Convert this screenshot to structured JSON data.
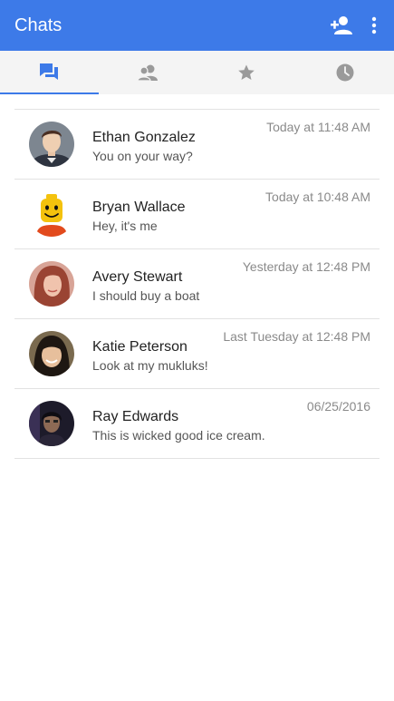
{
  "appbar": {
    "title": "Chats",
    "background": "#3d7ae8"
  },
  "icons": {
    "add_person": "add-person-icon",
    "more": "more-vert-icon"
  },
  "tabs": [
    {
      "name": "chats",
      "icon": "chat-bubbles-icon",
      "active": true
    },
    {
      "name": "contacts",
      "icon": "contacts-icon",
      "active": false
    },
    {
      "name": "favorites",
      "icon": "star-icon",
      "active": false
    },
    {
      "name": "recent",
      "icon": "clock-icon",
      "active": false
    }
  ],
  "chats": [
    {
      "name": "Ethan Gonzalez",
      "message": "You on your way?",
      "time": "Today at 11:48 AM"
    },
    {
      "name": "Bryan Wallace",
      "message": "Hey, it's me",
      "time": "Today at 10:48 AM"
    },
    {
      "name": "Avery Stewart",
      "message": "I should buy a boat",
      "time": "Yesterday at 12:48 PM"
    },
    {
      "name": "Katie Peterson",
      "message": "Look at my mukluks!",
      "time": "Last Tuesday at 12:48 PM"
    },
    {
      "name": "Ray Edwards",
      "message": "This is wicked good ice cream.",
      "time": "06/25/2016"
    }
  ]
}
